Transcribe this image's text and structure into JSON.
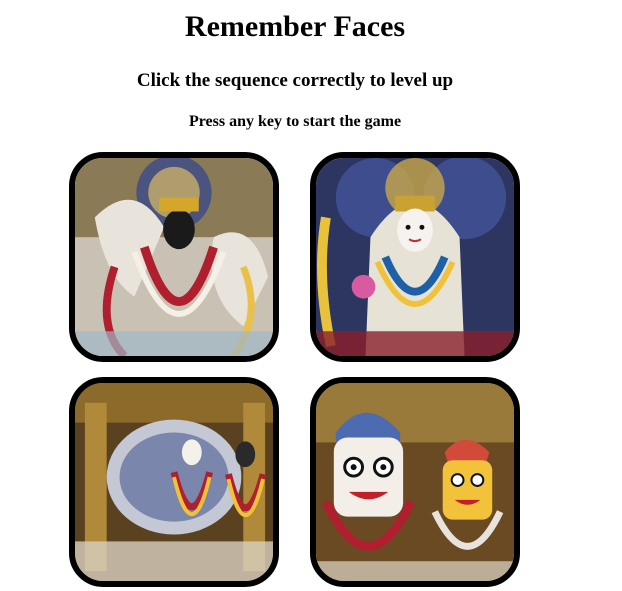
{
  "header": {
    "title": "Remember Faces",
    "subtitle": "Click the sequence correctly to level up",
    "instruction": "Press any key to start the game"
  },
  "tiles": [
    {
      "name": "deity-image-1",
      "description": "dark-faced deity with red and white garlands"
    },
    {
      "name": "deity-image-2",
      "description": "white-faced deity with jewel crown and garlands"
    },
    {
      "name": "deity-image-3",
      "description": "altar with two deities"
    },
    {
      "name": "deity-image-4",
      "description": "two deities with large painted faces"
    }
  ],
  "colors": {
    "background": "#ffffff",
    "text": "#000000",
    "tile_border": "#000000"
  }
}
